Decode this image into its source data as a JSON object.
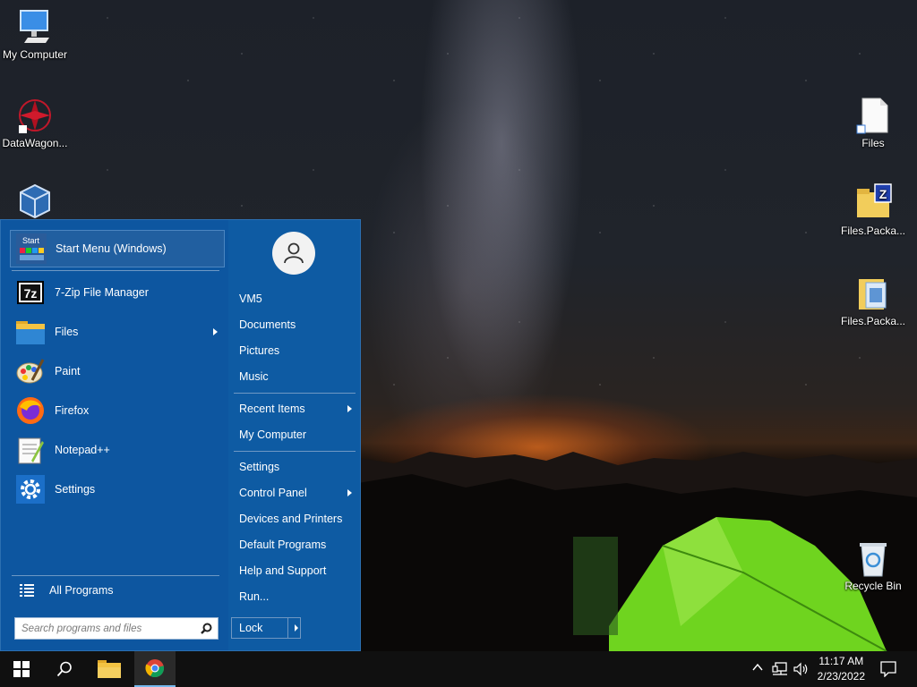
{
  "desktop": {
    "icons_left": [
      {
        "label": "My Computer",
        "icon": "monitor-icon"
      },
      {
        "label": "DataWagon...",
        "icon": "datawagon-icon"
      },
      {
        "label": "",
        "icon": "virtualbox-icon"
      }
    ],
    "icons_right": [
      {
        "label": "Files",
        "icon": "file-shortcut-icon"
      },
      {
        "label": "Files.Packa...",
        "icon": "zip-folder-icon"
      },
      {
        "label": "Files.Packa...",
        "icon": "package-icon"
      },
      {
        "label": "Recycle Bin",
        "icon": "recycle-bin-icon"
      }
    ]
  },
  "start_menu": {
    "pinned_header": {
      "label": "Start Menu (Windows)",
      "icon_text": "Start"
    },
    "programs": [
      {
        "label": "7-Zip File Manager",
        "icon": "7zip-icon",
        "submenu": false
      },
      {
        "label": "Files",
        "icon": "folder-icon",
        "submenu": true
      },
      {
        "label": "Paint",
        "icon": "paint-icon",
        "submenu": false
      },
      {
        "label": "Firefox",
        "icon": "firefox-icon",
        "submenu": false
      },
      {
        "label": "Notepad++",
        "icon": "notepadpp-icon",
        "submenu": false
      },
      {
        "label": "Settings",
        "icon": "gear-icon",
        "submenu": false
      }
    ],
    "all_programs": "All Programs",
    "search_placeholder": "Search programs and files",
    "right_items": [
      {
        "label": "VM5",
        "submenu": false
      },
      {
        "label": "Documents",
        "submenu": false
      },
      {
        "label": "Pictures",
        "submenu": false
      },
      {
        "label": "Music",
        "submenu": false
      },
      {
        "label": "Recent Items",
        "submenu": true
      },
      {
        "label": "My Computer",
        "submenu": false
      },
      {
        "label": "Settings",
        "submenu": false
      },
      {
        "label": "Control Panel",
        "submenu": true
      },
      {
        "label": "Devices and Printers",
        "submenu": false
      },
      {
        "label": "Default Programs",
        "submenu": false
      },
      {
        "label": "Help and Support",
        "submenu": false
      },
      {
        "label": "Run...",
        "submenu": false
      }
    ],
    "lock_label": "Lock"
  },
  "taskbar": {
    "time": "11:17 AM",
    "date": "2/23/2022",
    "accent": "#76b9ed"
  }
}
